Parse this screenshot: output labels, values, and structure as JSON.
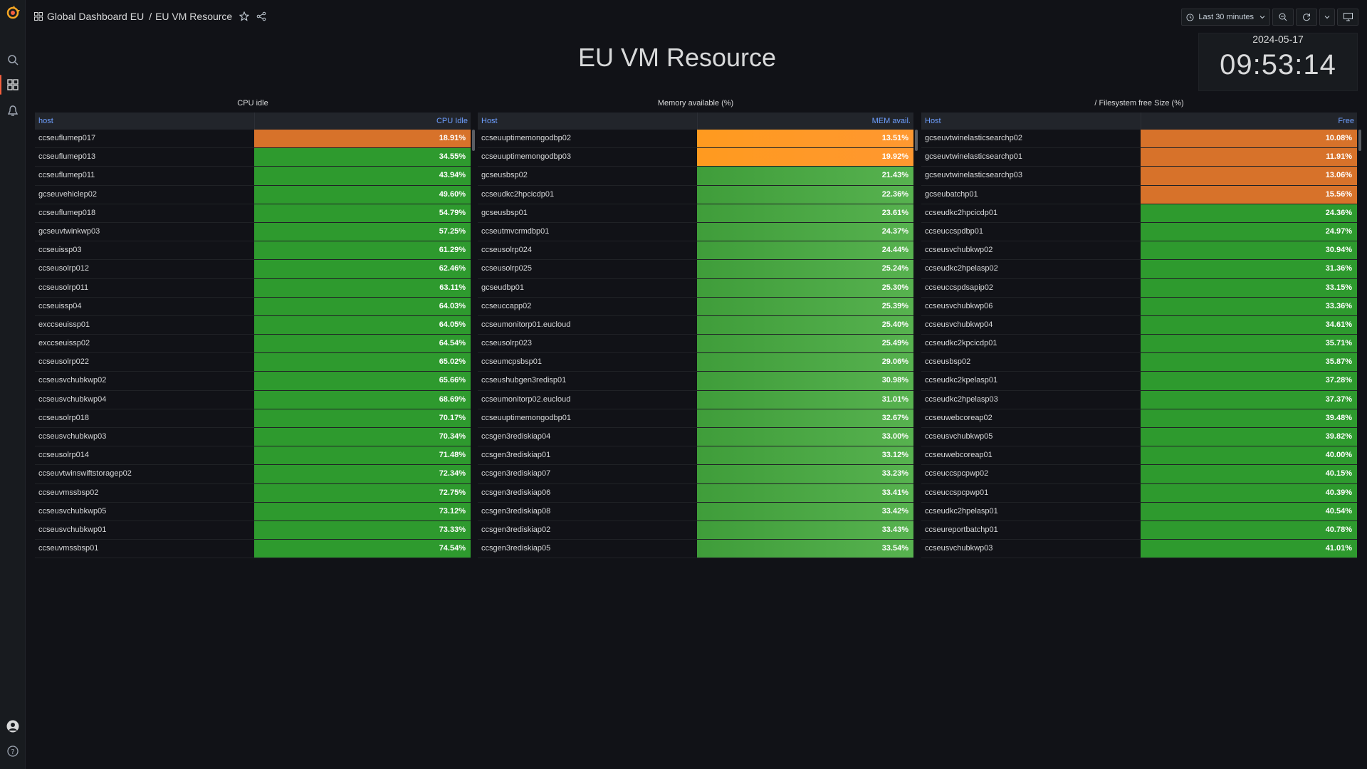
{
  "breadcrumb": {
    "folder": "Global Dashboard EU",
    "dashboard": "EU VM Resource"
  },
  "toolbar": {
    "time_range": "Last 30 minutes"
  },
  "title": "EU VM Resource",
  "clock": {
    "date": "2024-05-17",
    "time": "09:53:14"
  },
  "colors": {
    "green": "#2e9a2e",
    "light_green": "#48a843",
    "orange": "#ff9830",
    "dark_orange": "#d7722a",
    "brand": "#f55f3e"
  },
  "panels": [
    {
      "title": "CPU idle",
      "col1": "host",
      "col2": "CPU Idle",
      "rows": [
        {
          "host": "ccseuflumep017",
          "value": "18.91%",
          "status": "dark_orange"
        },
        {
          "host": "ccseuflumep013",
          "value": "34.55%",
          "status": "green"
        },
        {
          "host": "ccseuflumep011",
          "value": "43.94%",
          "status": "green"
        },
        {
          "host": "gcseuvehiclep02",
          "value": "49.60%",
          "status": "green"
        },
        {
          "host": "ccseuflumep018",
          "value": "54.79%",
          "status": "green"
        },
        {
          "host": "gcseuvtwinkwp03",
          "value": "57.25%",
          "status": "green"
        },
        {
          "host": "ccseuissp03",
          "value": "61.29%",
          "status": "green"
        },
        {
          "host": "ccseusolrp012",
          "value": "62.46%",
          "status": "green"
        },
        {
          "host": "ccseusolrp011",
          "value": "63.11%",
          "status": "green"
        },
        {
          "host": "ccseuissp04",
          "value": "64.03%",
          "status": "green"
        },
        {
          "host": "exccseuissp01",
          "value": "64.05%",
          "status": "green"
        },
        {
          "host": "exccseuissp02",
          "value": "64.54%",
          "status": "green"
        },
        {
          "host": "ccseusolrp022",
          "value": "65.02%",
          "status": "green"
        },
        {
          "host": "ccseusvchubkwp02",
          "value": "65.66%",
          "status": "green"
        },
        {
          "host": "ccseusvchubkwp04",
          "value": "68.69%",
          "status": "green"
        },
        {
          "host": "ccseusolrp018",
          "value": "70.17%",
          "status": "green"
        },
        {
          "host": "ccseusvchubkwp03",
          "value": "70.34%",
          "status": "green"
        },
        {
          "host": "ccseusolrp014",
          "value": "71.48%",
          "status": "green"
        },
        {
          "host": "ccseuvtwinswiftstoragep02",
          "value": "72.34%",
          "status": "green"
        },
        {
          "host": "ccseuvmssbsp02",
          "value": "72.75%",
          "status": "green"
        },
        {
          "host": "ccseusvchubkwp05",
          "value": "73.12%",
          "status": "green"
        },
        {
          "host": "ccseusvchubkwp01",
          "value": "73.33%",
          "status": "green"
        },
        {
          "host": "ccseuvmssbsp01",
          "value": "74.54%",
          "status": "green"
        }
      ]
    },
    {
      "title": "Memory available (%)",
      "col1": "Host",
      "col2": "MEM avail.",
      "rows": [
        {
          "host": "ccseuuptimemongodbp02",
          "value": "13.51%",
          "status": "orange"
        },
        {
          "host": "ccseuuptimemongodbp03",
          "value": "19.92%",
          "status": "orange"
        },
        {
          "host": "gcseusbsp02",
          "value": "21.43%",
          "status": "light_green"
        },
        {
          "host": "ccseudkc2hpcicdp01",
          "value": "22.36%",
          "status": "light_green"
        },
        {
          "host": "gcseusbsp01",
          "value": "23.61%",
          "status": "light_green"
        },
        {
          "host": "ccseutmvcrmdbp01",
          "value": "24.37%",
          "status": "light_green"
        },
        {
          "host": "ccseusolrp024",
          "value": "24.44%",
          "status": "light_green"
        },
        {
          "host": "ccseusolrp025",
          "value": "25.24%",
          "status": "light_green"
        },
        {
          "host": "gcseudbp01",
          "value": "25.30%",
          "status": "light_green"
        },
        {
          "host": "ccseuccapp02",
          "value": "25.39%",
          "status": "light_green"
        },
        {
          "host": "ccseumonitorp01.eucloud",
          "value": "25.40%",
          "status": "light_green"
        },
        {
          "host": "ccseusolrp023",
          "value": "25.49%",
          "status": "light_green"
        },
        {
          "host": "ccseumcpsbsp01",
          "value": "29.06%",
          "status": "light_green"
        },
        {
          "host": "ccseushubgen3redisp01",
          "value": "30.98%",
          "status": "light_green"
        },
        {
          "host": "ccseumonitorp02.eucloud",
          "value": "31.01%",
          "status": "light_green"
        },
        {
          "host": "ccseuuptimemongodbp01",
          "value": "32.67%",
          "status": "light_green"
        },
        {
          "host": "ccsgen3rediskiap04",
          "value": "33.00%",
          "status": "light_green"
        },
        {
          "host": "ccsgen3rediskiap01",
          "value": "33.12%",
          "status": "light_green"
        },
        {
          "host": "ccsgen3rediskiap07",
          "value": "33.23%",
          "status": "light_green"
        },
        {
          "host": "ccsgen3rediskiap06",
          "value": "33.41%",
          "status": "light_green"
        },
        {
          "host": "ccsgen3rediskiap08",
          "value": "33.42%",
          "status": "light_green"
        },
        {
          "host": "ccsgen3rediskiap02",
          "value": "33.43%",
          "status": "light_green"
        },
        {
          "host": "ccsgen3rediskiap05",
          "value": "33.54%",
          "status": "light_green"
        }
      ]
    },
    {
      "title": "/ Filesystem free Size (%)",
      "col1": "Host",
      "col2": "Free",
      "rows": [
        {
          "host": "gcseuvtwinelasticsearchp02",
          "value": "10.08%",
          "status": "dark_orange"
        },
        {
          "host": "gcseuvtwinelasticsearchp01",
          "value": "11.91%",
          "status": "dark_orange"
        },
        {
          "host": "gcseuvtwinelasticsearchp03",
          "value": "13.06%",
          "status": "dark_orange"
        },
        {
          "host": "gcseubatchp01",
          "value": "15.56%",
          "status": "dark_orange"
        },
        {
          "host": "ccseudkc2hpcicdp01",
          "value": "24.36%",
          "status": "green"
        },
        {
          "host": "ccseuccspdbp01",
          "value": "24.97%",
          "status": "green"
        },
        {
          "host": "ccseusvchubkwp02",
          "value": "30.94%",
          "status": "green"
        },
        {
          "host": "ccseudkc2hpelasp02",
          "value": "31.36%",
          "status": "green"
        },
        {
          "host": "ccseuccspdsapip02",
          "value": "33.15%",
          "status": "green"
        },
        {
          "host": "ccseusvchubkwp06",
          "value": "33.36%",
          "status": "green"
        },
        {
          "host": "ccseusvchubkwp04",
          "value": "34.61%",
          "status": "green"
        },
        {
          "host": "ccseudkc2kpcicdp01",
          "value": "35.71%",
          "status": "green"
        },
        {
          "host": "ccseusbsp02",
          "value": "35.87%",
          "status": "green"
        },
        {
          "host": "ccseudkc2kpelasp01",
          "value": "37.28%",
          "status": "green"
        },
        {
          "host": "ccseudkc2hpelasp03",
          "value": "37.37%",
          "status": "green"
        },
        {
          "host": "ccseuwebcoreap02",
          "value": "39.48%",
          "status": "green"
        },
        {
          "host": "ccseusvchubkwp05",
          "value": "39.82%",
          "status": "green"
        },
        {
          "host": "ccseuwebcoreap01",
          "value": "40.00%",
          "status": "green"
        },
        {
          "host": "ccseuccspcpwp02",
          "value": "40.15%",
          "status": "green"
        },
        {
          "host": "ccseuccspcpwp01",
          "value": "40.39%",
          "status": "green"
        },
        {
          "host": "ccseudkc2hpelasp01",
          "value": "40.54%",
          "status": "green"
        },
        {
          "host": "ccseureportbatchp01",
          "value": "40.78%",
          "status": "green"
        },
        {
          "host": "ccseusvchubkwp03",
          "value": "41.01%",
          "status": "green"
        }
      ]
    }
  ]
}
